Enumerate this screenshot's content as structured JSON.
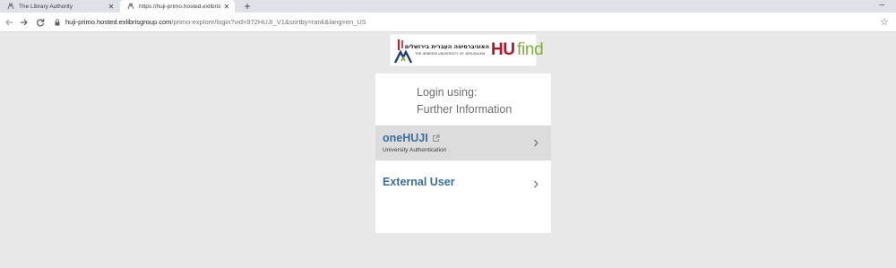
{
  "browser": {
    "tabs": [
      {
        "title": "The Library Authority",
        "close": "✕"
      },
      {
        "title": "https://huji-primo.hosted.exlibris",
        "close": "✕"
      }
    ],
    "new_tab": "+",
    "minimize": "–",
    "url_host": "huji-primo.hosted.exlibrisgroup.com",
    "url_rest": "/primo-explore/login?vid=972HUJI_V1&sortby=rank&lang=en_US",
    "bookmark_star": "☆"
  },
  "logo": {
    "hebrew": "האוניברסיטה העברית בירושלים",
    "english": "THE HEBREW UNIVERSITY OF JERUSALEM",
    "hu": "HU",
    "find": "find",
    "colors": {
      "red": "#b8122d",
      "green": "#7fb038"
    }
  },
  "login": {
    "heading_line1": "Login using:",
    "heading_line2": "Further Information",
    "options": [
      {
        "name": "oneHUJI",
        "description": "University Authentication",
        "icon": "external-link-icon"
      },
      {
        "name": "External User",
        "description": ""
      }
    ],
    "colors": {
      "link": "#3b6e9a",
      "selected_bg": "#dcdcdc"
    }
  }
}
